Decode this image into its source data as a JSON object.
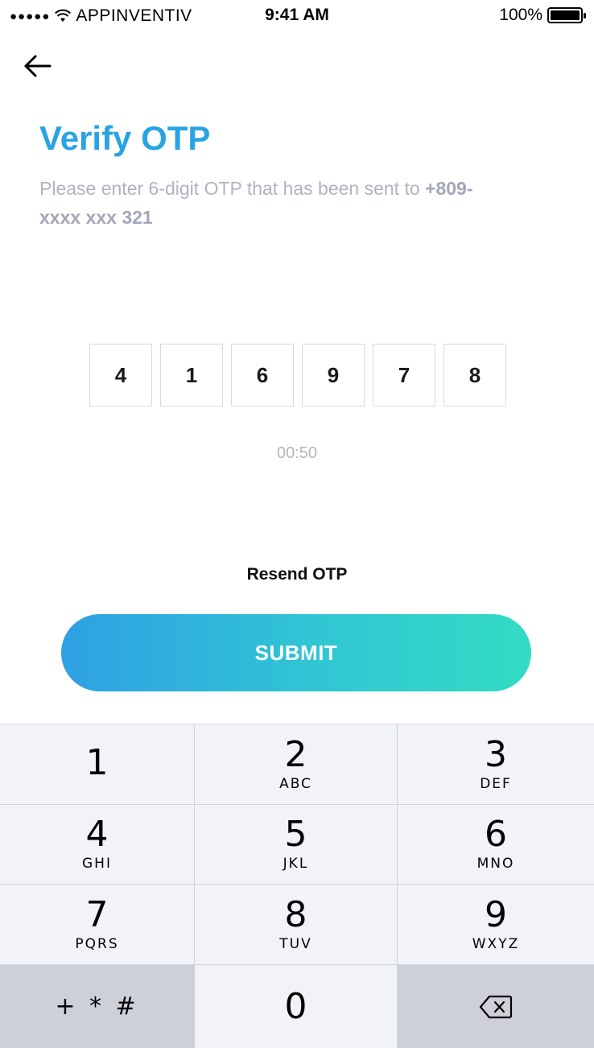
{
  "status_bar": {
    "signal": "●●●●●",
    "carrier": "APPINVENTIV",
    "time": "9:41 AM",
    "battery": "100%",
    "battery_level": 1.0
  },
  "header": {
    "back_icon": "arrow-left-icon",
    "title": "Verify OTP",
    "subtitle_text": "Please enter 6-digit OTP that has been sent to",
    "phone": "+809-xxxx xxx 321"
  },
  "otp": {
    "digits": [
      "4",
      "1",
      "6",
      "9",
      "7",
      "8"
    ],
    "timer": "00:50",
    "resend_label": "Resend OTP"
  },
  "submit": {
    "label": "SUBMIT"
  },
  "colors": {
    "title": "#2aa3e3",
    "gradient_start": "#2fa0e4",
    "gradient_end": "#33dcc3",
    "keypad_bg": "#f2f3f8"
  },
  "keypad": {
    "keys": [
      {
        "digit": "1",
        "letters": ""
      },
      {
        "digit": "2",
        "letters": "ABC"
      },
      {
        "digit": "3",
        "letters": "DEF"
      },
      {
        "digit": "4",
        "letters": "GHI"
      },
      {
        "digit": "5",
        "letters": "JKL"
      },
      {
        "digit": "6",
        "letters": "MNO"
      },
      {
        "digit": "7",
        "letters": "PQRS"
      },
      {
        "digit": "8",
        "letters": "TUV"
      },
      {
        "digit": "9",
        "letters": "WXYZ"
      }
    ],
    "symbols": "+ * #",
    "zero": "0",
    "delete_icon": "backspace-icon"
  }
}
